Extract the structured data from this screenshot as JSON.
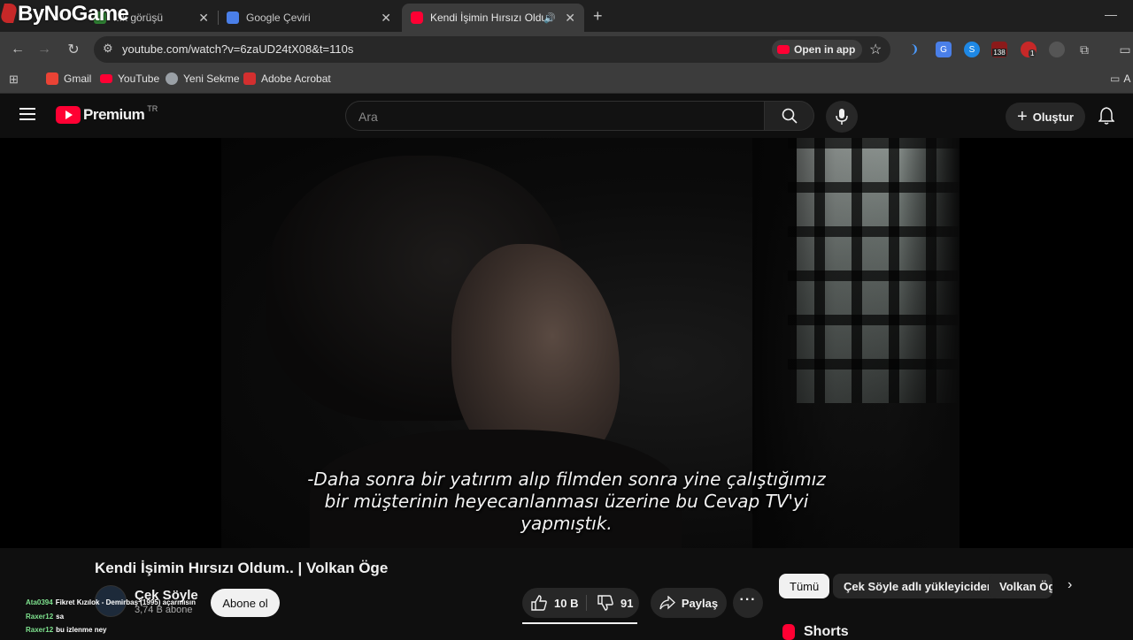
{
  "browser": {
    "tabs": [
      {
        "label": "...k görüşü",
        "favicon": "green-icon"
      },
      {
        "label": "Google Çeviri",
        "favicon": "translate-icon"
      },
      {
        "label": "Kendi İşimin Hırsızı Oldum..",
        "favicon": "youtube-icon"
      }
    ],
    "url": "youtube.com/watch?v=6zaUD24tX08&t=110s",
    "open_in_app": "Open in app",
    "extension_badge_count": "138",
    "extension_badge_small": "1"
  },
  "bookmarks": [
    {
      "label": "Gmail",
      "icon": "gmail-icon"
    },
    {
      "label": "YouTube",
      "icon": "youtube-icon"
    },
    {
      "label": "Yeni Sekme",
      "icon": "globe-icon"
    },
    {
      "label": "Adobe Acrobat",
      "icon": "acrobat-icon"
    }
  ],
  "bookmarks_overflow": "A",
  "youtube": {
    "logo_text": "Premium",
    "region": "TR",
    "search_placeholder": "Ara",
    "create_label": "Oluştur"
  },
  "video": {
    "subtitle_lines": [
      "-Daha sonra bir yatırım alıp filmden sonra yine çalıştığımız",
      "bir müşterinin heyecanlanması üzerine bu Cevap TV'yi",
      "yapmıştık."
    ],
    "title": "Kendi İşimin Hırsızı Oldum.. | Volkan Öge"
  },
  "channel": {
    "name": "Çek Söyle",
    "subscribers": "3,74 B abone",
    "subscribe_label": "Abone ol"
  },
  "actions": {
    "likes": "10 B",
    "dislikes": "91",
    "share": "Paylaş"
  },
  "chips": [
    "Tümü",
    "Çek Söyle adlı yükleyiciden",
    "Volkan Öge"
  ],
  "shorts_label": "Shorts",
  "chat": [
    {
      "user": "Ata0394",
      "text": "Fikret Kızılok - Demirbaş (1995) açarmısın"
    },
    {
      "user": "Raxer12",
      "text": "sa"
    },
    {
      "user": "Raxer12",
      "text": "bu izlenme ney"
    }
  ],
  "watermark": "ByNoGame",
  "colors": {
    "youtube_red": "#ff0033",
    "background": "#0f0f0f",
    "chrome_toolbar": "#3c3c3c"
  }
}
